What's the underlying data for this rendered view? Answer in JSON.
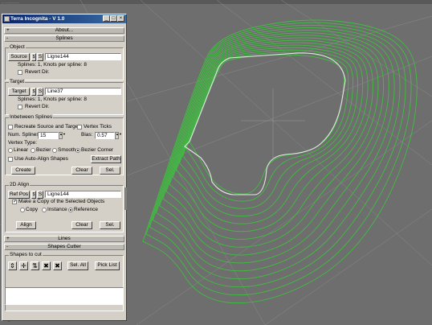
{
  "topbar": {
    "label": "...................."
  },
  "window": {
    "title": "Terra Incognita - V 1.0",
    "minimize": "_",
    "maximize": "□",
    "close": "×"
  },
  "rollouts": {
    "about": {
      "sign": "+",
      "label": "About..."
    },
    "splines": {
      "sign": "-",
      "label": "Splines"
    },
    "lines": {
      "sign": "+",
      "label": "Lines"
    },
    "shapes_cutter": {
      "sign": "-",
      "label": "Shapes Cutter"
    }
  },
  "object": {
    "title": "Object",
    "source_button": "Source",
    "sel_button": "S",
    "field": "Ligne144",
    "info": "Splines: 1,  Knots per spline: 8",
    "revert_label": "Revert Dir.",
    "revert_checked": false
  },
  "target": {
    "title": "Target",
    "target_button": "Target",
    "sel_button": "S",
    "field": "Line37",
    "info": "Splines: 1,  Knots per spline: 8",
    "revert_label": "Revert Dir.",
    "revert_checked": false
  },
  "inbetween": {
    "title": "Inbetween Splines",
    "recreate_label": "Recreate Source and Target",
    "recreate_checked": false,
    "vertex_ticks_label": "Vertex Ticks",
    "vertex_ticks_checked": false,
    "num_splines_label": "Num. Splines:",
    "num_splines_value": "15",
    "bias_label": "Bias:",
    "bias_value": "0.57",
    "vertex_type_label": "Vertex Type:",
    "vertex_types": [
      "Linear",
      "Bezier",
      "Smooth",
      "Bezier Corner"
    ],
    "vertex_selected": "Bezier Corner",
    "auto_align_label": "Use Auto-Align Shapes",
    "auto_align_checked": false,
    "extract_path_button": "Extract Path",
    "create_button": "Create",
    "clear_button": "Clear",
    "sel_button": "Sel."
  },
  "align2d": {
    "title": "2D Align",
    "refpos_button": "Ref Pos",
    "sel_button": "S",
    "field": "Ligne144",
    "make_copy_label": "Make a Copy of the Selected Objects",
    "make_copy_checked": true,
    "copy_types": [
      "Copy",
      "Instance",
      "Reference"
    ],
    "copy_selected": "Reference",
    "align_button": "Align",
    "clear_button": "Clear",
    "sel_button2": "Sel."
  },
  "shapes_to_cut": {
    "title": "Shapes to cut",
    "icons": [
      "add-icon",
      "pick-icon",
      "swap-icon",
      "remove-icon",
      "delete-all-icon"
    ],
    "sel_all_button": "Sel. All",
    "pick_list_button": "Pick List"
  },
  "colors": {
    "viewport": "#6e6e6e",
    "title_start": "#0a246a",
    "title_end": "#3a6ea5",
    "panel": "#d4d0c8",
    "contour_green": "#3fbf3f",
    "contour_white": "#e6e6e6",
    "grid": "#8a8a8a"
  },
  "chart_data": {
    "type": "viewport",
    "contours": {
      "green_count": 15
    }
  }
}
